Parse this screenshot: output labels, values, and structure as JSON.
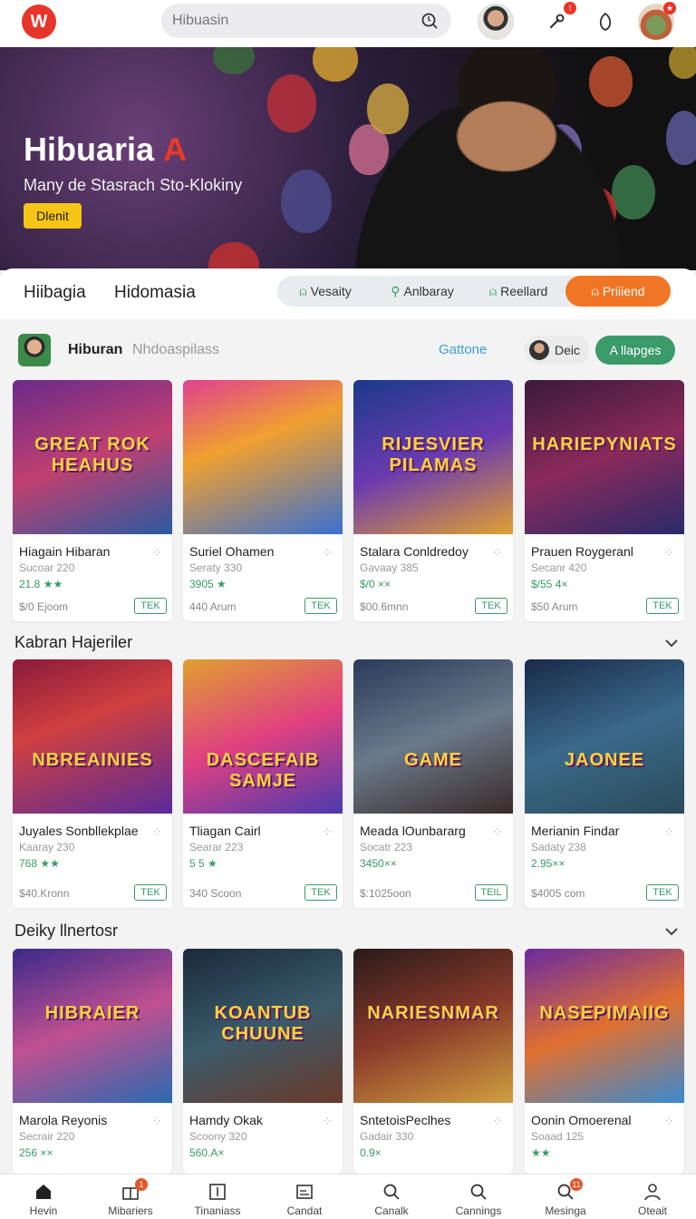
{
  "app": {
    "logo_text": "W"
  },
  "search": {
    "placeholder": "Hibuasin"
  },
  "hero": {
    "title": "Hibuaria",
    "title_accent": "A",
    "subtitle": "Many de Stasrach Sto-Klokiny",
    "button": "Dlenit"
  },
  "tabs": {
    "primary": [
      "Hiibagia",
      "Hidomasia"
    ],
    "pills": [
      {
        "label": "Vesaity",
        "icon": "person-icon",
        "active": false
      },
      {
        "label": "Anlbaray",
        "icon": "search-icon",
        "active": false
      },
      {
        "label": "Reellard",
        "icon": "person-icon",
        "active": false
      },
      {
        "label": "Priiiend",
        "icon": "person-icon",
        "active": true
      }
    ]
  },
  "section": {
    "title": "Hiburan",
    "subtitle": "Nhdoaspilass",
    "link": "Gattone",
    "chip": "Deic",
    "button": "A llapges"
  },
  "rows": [
    {
      "header": "",
      "cards": [
        {
          "name": "Hiagain Hibaran",
          "meta": "Sucoar 220",
          "rating": "21.8 ★★",
          "price": "$/0 Ejoom",
          "action": "TEK",
          "thumb_text": "GREAT ROK HEAHUS"
        },
        {
          "name": "Suriel Ohamen",
          "meta": "Seraty 330",
          "rating": "3905 ★",
          "price": "440 Arum",
          "action": "TEK",
          "thumb_text": ""
        },
        {
          "name": "Stalara Conldredoy",
          "meta": "Gavaay 385",
          "rating": "$/0 ××",
          "price": "$00.6mnn",
          "action": "TEK",
          "thumb_text": "RIJESVIER PILAMAS"
        },
        {
          "name": "Prauen Roygeranl",
          "meta": "Secanr 420",
          "rating": "$/55 4×",
          "price": "$50 Arum",
          "action": "TEK",
          "thumb_text": "HARIEPYNIATS"
        }
      ]
    },
    {
      "header": "Kabran Hajeriler",
      "cards": [
        {
          "name": "Juyales Sonbllekplae",
          "meta": "Kaaray 230",
          "rating": "768 ★★",
          "price": "$40.Kronn",
          "action": "TEK",
          "thumb_text": "NBREAINIES"
        },
        {
          "name": "Tliagan Cairl",
          "meta": "Searar 223",
          "rating": "5 5 ★",
          "price": "340 Scoon",
          "action": "TEK",
          "thumb_text": "DASCEFAIB SAMJE"
        },
        {
          "name": "Meada lOunbararg",
          "meta": "Socatr 223",
          "rating": "3450××",
          "price": "$:1025oon",
          "action": "TEIL",
          "thumb_text": "GAME"
        },
        {
          "name": "Merianin Findar",
          "meta": "Sadaty 238",
          "rating": "2.95××",
          "price": "$4005 com",
          "action": "TEK",
          "thumb_text": "JAONEE"
        }
      ]
    },
    {
      "header": "Deiky llnertosr",
      "cards": [
        {
          "name": "Marola Reyonis",
          "meta": "Secrair 220",
          "rating": "256 ××",
          "price": "",
          "action": "",
          "thumb_text": "HIBRAIER"
        },
        {
          "name": "Hamdy Okak",
          "meta": "Scoony 320",
          "rating": "560.A×",
          "price": "",
          "action": "",
          "thumb_text": "KOANTUB CHUUNE"
        },
        {
          "name": "SntetoisPeclhes",
          "meta": "Gadair 330",
          "rating": "0.9×",
          "price": "",
          "action": "",
          "thumb_text": "NARIESNMAR"
        },
        {
          "name": "Oonin Omoerenal",
          "meta": "Soaad 125",
          "rating": "★★",
          "price": "",
          "action": "",
          "thumb_text": "NASEPIMAIIG"
        }
      ]
    }
  ],
  "bottom_nav": [
    {
      "label": "Hevin",
      "icon": "home-icon",
      "badge": ""
    },
    {
      "label": "Mibariers",
      "icon": "gift-icon",
      "badge": "1"
    },
    {
      "label": "Tinaniass",
      "icon": "grid-icon",
      "badge": ""
    },
    {
      "label": "Candat",
      "icon": "chart-icon",
      "badge": ""
    },
    {
      "label": "Canalk",
      "icon": "search-icon",
      "badge": ""
    },
    {
      "label": "Cannings",
      "icon": "search-icon",
      "badge": ""
    },
    {
      "label": "Mesinga",
      "icon": "search-icon",
      "badge": "11"
    },
    {
      "label": "Oteait",
      "icon": "user-icon",
      "badge": ""
    }
  ],
  "colors": {
    "brand": "#e8352a",
    "accent": "#f07524",
    "green": "#3a9a6a",
    "link": "#3aa0d8"
  }
}
